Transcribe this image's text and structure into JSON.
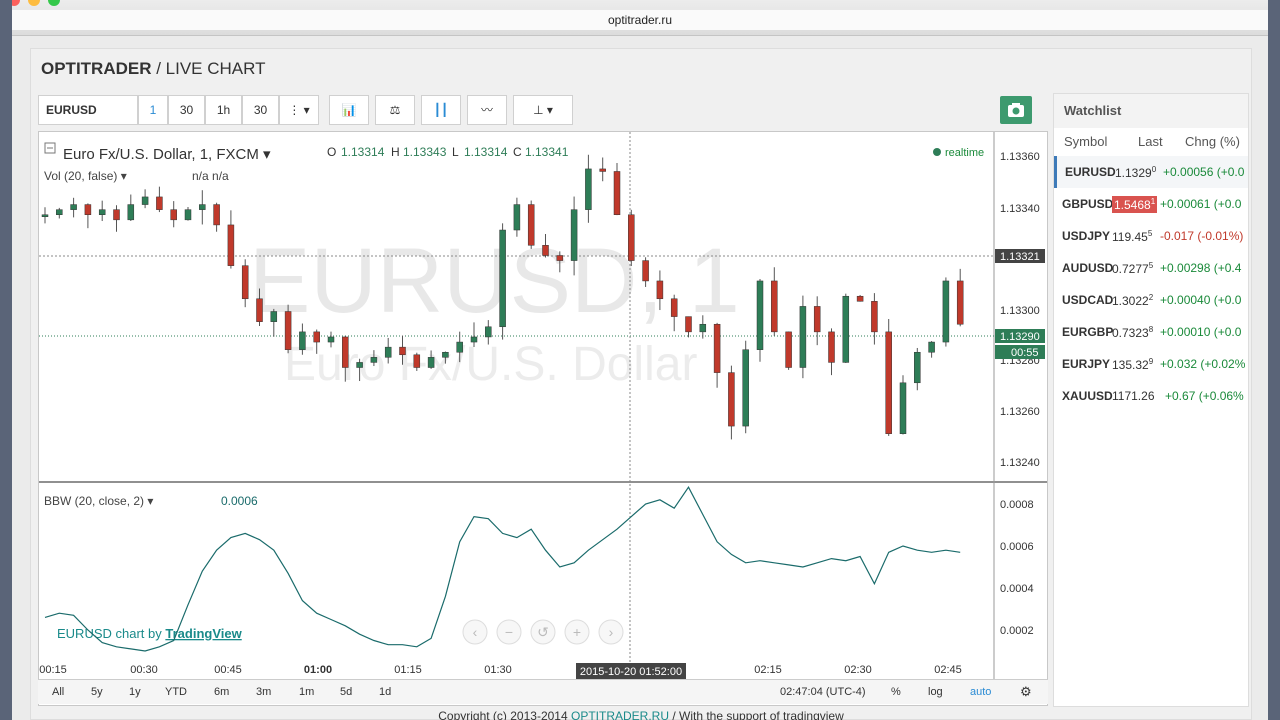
{
  "browser": {
    "url": "optitrader.ru"
  },
  "page": {
    "title_bold": "OPTITRADER",
    "title_rest": " / LIVE CHART"
  },
  "toolbar": {
    "symbol": "EURUSD",
    "intervals": [
      "1",
      "30",
      "1h",
      "30"
    ]
  },
  "legend": {
    "symbol_name": "Euro Fx/U.S. Dollar, 1, FXCM",
    "o_label": "O",
    "o": "1.13314",
    "h_label": "H",
    "h": "1.13343",
    "l_label": "L",
    "l": "1.13314",
    "c_label": "C",
    "c": "1.13341",
    "realtime": "realtime",
    "vol": "Vol (20, false)",
    "vol_vals": "n/a  n/a",
    "bbw": "BBW (20, close, 2)",
    "bbw_val": "0.0006",
    "watermark1": "EURUSD, 1",
    "watermark2": "Euro Fx/U.S. Dollar",
    "attribution_pre": "EURUSD chart by ",
    "attribution_link": "TradingView",
    "price_marker": "1.13321",
    "price_marker2": "1.13290",
    "timer": "00:55",
    "crosshair_time": "2015-10-20 01:52:00"
  },
  "price_axis": [
    "1.13360",
    "1.13340",
    "1.13300",
    "1.13280",
    "1.13260",
    "1.13240"
  ],
  "bbw_axis": [
    "0.0008",
    "0.0006",
    "0.0004",
    "0.0002"
  ],
  "time_axis": [
    "00:15",
    "00:30",
    "00:45",
    "01:00",
    "01:15",
    "01:30",
    "02:15",
    "02:30",
    "02:45"
  ],
  "range": {
    "buttons": [
      "All",
      "5y",
      "1y",
      "YTD",
      "6m",
      "3m",
      "1m",
      "5d",
      "1d"
    ],
    "clock": "02:47:04 (UTC-4)",
    "pct": "%",
    "log": "log",
    "auto": "auto"
  },
  "watchlist": {
    "title": "Watchlist",
    "cols": [
      "Symbol",
      "Last",
      "Chng (%)"
    ],
    "rows": [
      {
        "sym": "EURUSD",
        "last": "1.1329",
        "sup": "0",
        "chg": "+0.00056 (+0.0",
        "color": "#1a8a3a"
      },
      {
        "sym": "GBPUSD",
        "last": "1.5468",
        "sup": "1",
        "chg": "+0.00061 (+0.0",
        "color": "#1a8a3a"
      },
      {
        "sym": "USDJPY",
        "last": "119.45",
        "sup": "5",
        "chg": "-0.017 (-0.01%)",
        "color": "#c0392b"
      },
      {
        "sym": "AUDUSD",
        "last": "0.7277",
        "sup": "5",
        "chg": "+0.00298 (+0.4",
        "color": "#1a8a3a"
      },
      {
        "sym": "USDCAD",
        "last": "1.3022",
        "sup": "2",
        "chg": "+0.00040 (+0.0",
        "color": "#1a8a3a"
      },
      {
        "sym": "EURGBP",
        "last": "0.7323",
        "sup": "8",
        "chg": "+0.00010 (+0.0",
        "color": "#1a8a3a"
      },
      {
        "sym": "EURJPY",
        "last": "135.32",
        "sup": "9",
        "chg": "+0.032 (+0.02%",
        "color": "#1a8a3a"
      },
      {
        "sym": "XAUUSD",
        "last": "1171.26",
        "sup": "",
        "chg": "+0.67 (+0.06%",
        "color": "#1a8a3a"
      }
    ]
  },
  "footer": {
    "text": "Copyright (c) 2013-2014 ",
    "link": "OPTITRADER.RU",
    "rest": " / With the support of tradingview"
  },
  "colors": {
    "up": "#2e7d57",
    "down": "#c0392b",
    "bbw": "#1a6b6b",
    "accent": "#3d9a6e"
  }
}
